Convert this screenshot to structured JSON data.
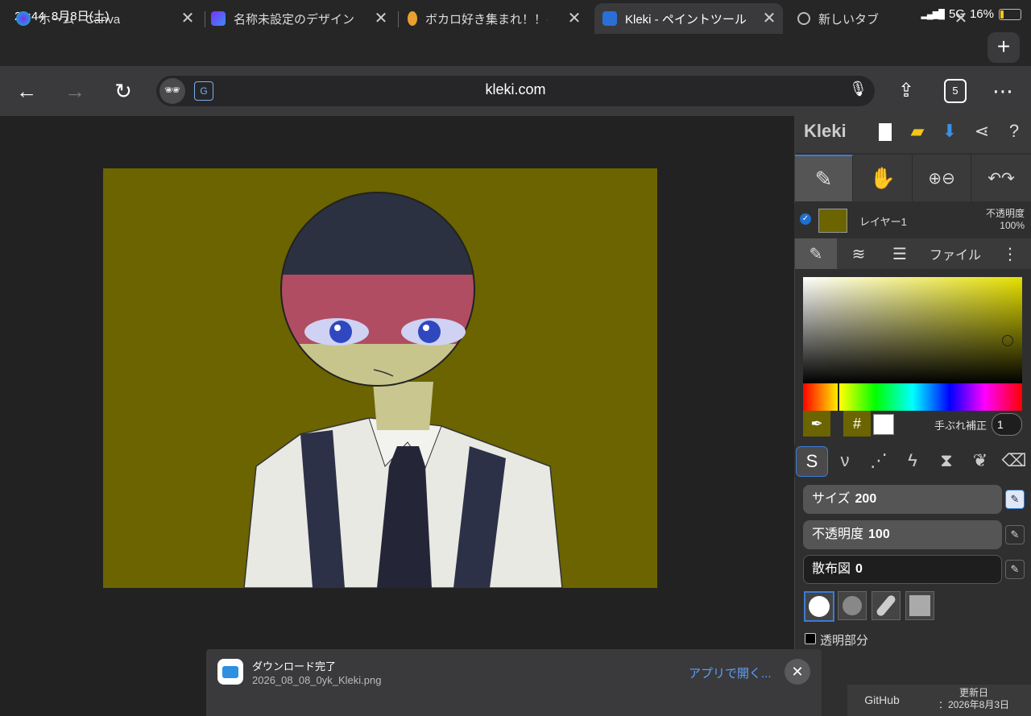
{
  "status": {
    "time": "20:44",
    "date": "8月8日(土)",
    "network": "5G",
    "battery": "16%"
  },
  "tabs": [
    {
      "label": "ホーム - Canva",
      "icon": "canva-icon"
    },
    {
      "label": "名称未設定のデザイン -",
      "icon": "video-icon"
    },
    {
      "label": "ボカロ好き集まれ！！·",
      "icon": "bean-icon"
    },
    {
      "label": "Kleki - ペイントツール",
      "icon": "kleki-icon",
      "active": true
    },
    {
      "label": "新しいタブ",
      "icon": "globe-icon"
    }
  ],
  "toolbar": {
    "url": "kleki.com",
    "tab_count": "5"
  },
  "kleki": {
    "logo": "Kleki",
    "layer": {
      "name": "レイヤー1",
      "opacity_label": "不透明度",
      "opacity_value": "100%"
    },
    "panel_tabs": {
      "file": "ファイル"
    },
    "color": {
      "hash": "#",
      "stabilizer_label": "手ぶれ補正",
      "stabilizer_value": "1"
    },
    "sliders": {
      "size_label": "サイズ",
      "size_value": "200",
      "opacity_label": "不透明度",
      "opacity_value": "100",
      "scatter_label": "散布図",
      "scatter_value": "0"
    },
    "alpha_label": "透明部分",
    "footer": {
      "github": "GitHub",
      "updated_line1": "更新日",
      "updated_line2": "：2026年8月3日"
    },
    "accent_color": "#6b6400"
  },
  "download": {
    "title": "ダウンロード完了",
    "filename": "2026_08_08_0yk_Kleki.png",
    "open_label": "アプリで開く..."
  }
}
